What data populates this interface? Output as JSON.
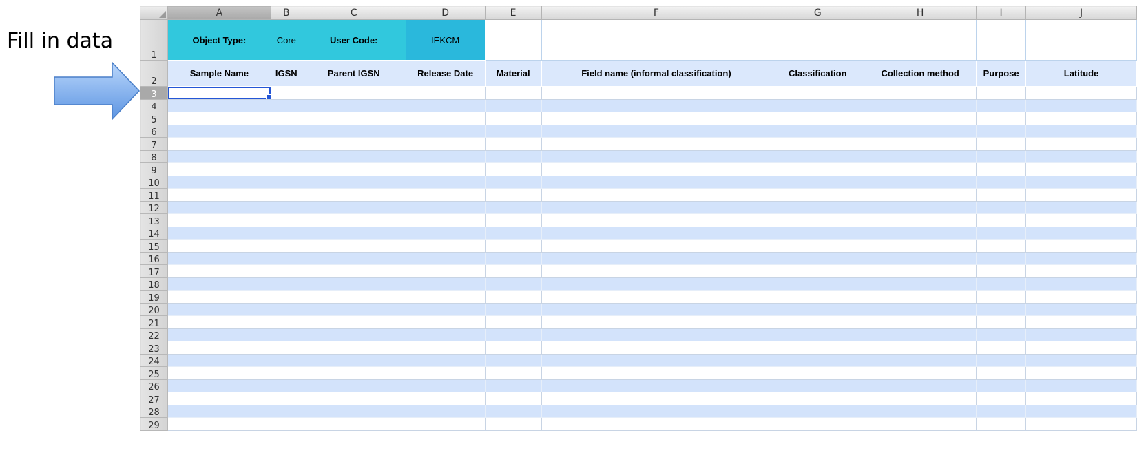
{
  "annotation": {
    "text": "Fill in data",
    "arrow_icon": "right-arrow-icon",
    "arrow_color": "#6fa5ec"
  },
  "columns": [
    "A",
    "B",
    "C",
    "D",
    "E",
    "F",
    "G",
    "H",
    "I",
    "J"
  ],
  "row1": {
    "number": "1",
    "cells": [
      "Object Type:",
      "Core",
      "User Code:",
      "IEKCM",
      "",
      "",
      "",
      "",
      "",
      ""
    ]
  },
  "row2": {
    "number": "2",
    "cells": [
      "Sample Name",
      "IGSN",
      "Parent IGSN",
      "Release Date",
      "Material",
      "Field name (informal classification)",
      "Classification",
      "Collection method",
      "Purpose",
      "Latitude"
    ]
  },
  "data_rows": [
    "3",
    "4",
    "5",
    "6",
    "7",
    "8",
    "9",
    "10",
    "11",
    "12",
    "13",
    "14",
    "15",
    "16",
    "17",
    "18",
    "19",
    "20",
    "21",
    "22",
    "23",
    "24",
    "25",
    "26",
    "27",
    "28",
    "29"
  ],
  "selection": {
    "active_cell": "A3"
  },
  "colors": {
    "header_cyan": "#31c8dd",
    "row_band": "#d3e3fb",
    "selection": "#2456d6"
  }
}
